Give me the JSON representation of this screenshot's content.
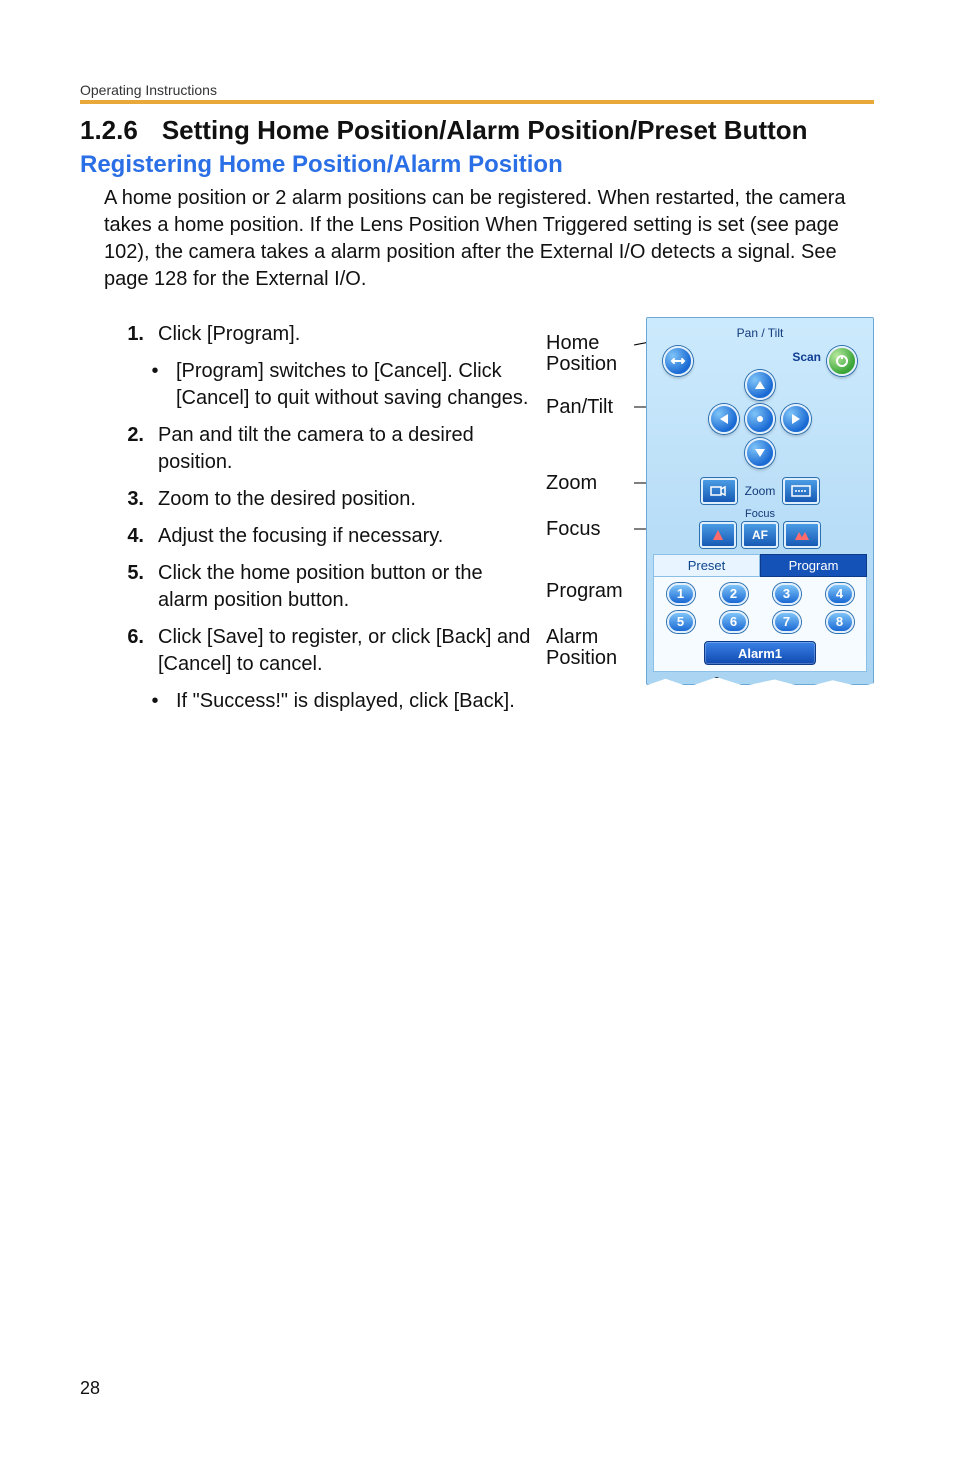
{
  "running_head": "Operating Instructions",
  "page_number": "28",
  "heading": {
    "number": "1.2.6",
    "title": "Setting Home Position/Alarm Position/Preset Button"
  },
  "subheading": "Registering Home Position/Alarm Position",
  "intro": "A home position or 2 alarm positions can be registered. When restarted, the camera takes a home position. If the Lens Position When Triggered setting is set (see page 102), the camera takes a alarm position after the External I/O detects a signal. See page 128 for the External I/O.",
  "steps": [
    {
      "n": "1.",
      "text": "Click [Program].",
      "subs": [
        "[Program] switches to [Cancel]. Click [Cancel] to quit without saving changes."
      ]
    },
    {
      "n": "2.",
      "text": "Pan and tilt the camera to a desired position."
    },
    {
      "n": "3.",
      "text": "Zoom to the desired position."
    },
    {
      "n": "4.",
      "text": "Adjust the focusing if necessary."
    },
    {
      "n": "5.",
      "text": "Click the home position button or the alarm position button."
    },
    {
      "n": "6.",
      "text": "Click [Save] to register, or click [Back] and [Cancel] to cancel.",
      "subs": [
        "If \"Success!\" is displayed, click [Back]."
      ]
    }
  ],
  "panel": {
    "pantilt_title": "Pan / Tilt",
    "scan_label": "Scan",
    "zoom_label": "Zoom",
    "focus_title": "Focus",
    "af_label": "AF",
    "tab_preset": "Preset",
    "tab_program": "Program",
    "presets": [
      "1",
      "2",
      "3",
      "4",
      "5",
      "6",
      "7",
      "8"
    ],
    "alarm_label": "Alarm1"
  },
  "callouts": {
    "home": "Home Position",
    "pantilt": "Pan/Tilt",
    "zoom": "Zoom",
    "focus": "Focus",
    "program": "Program",
    "alarm": "Alarm Position"
  }
}
